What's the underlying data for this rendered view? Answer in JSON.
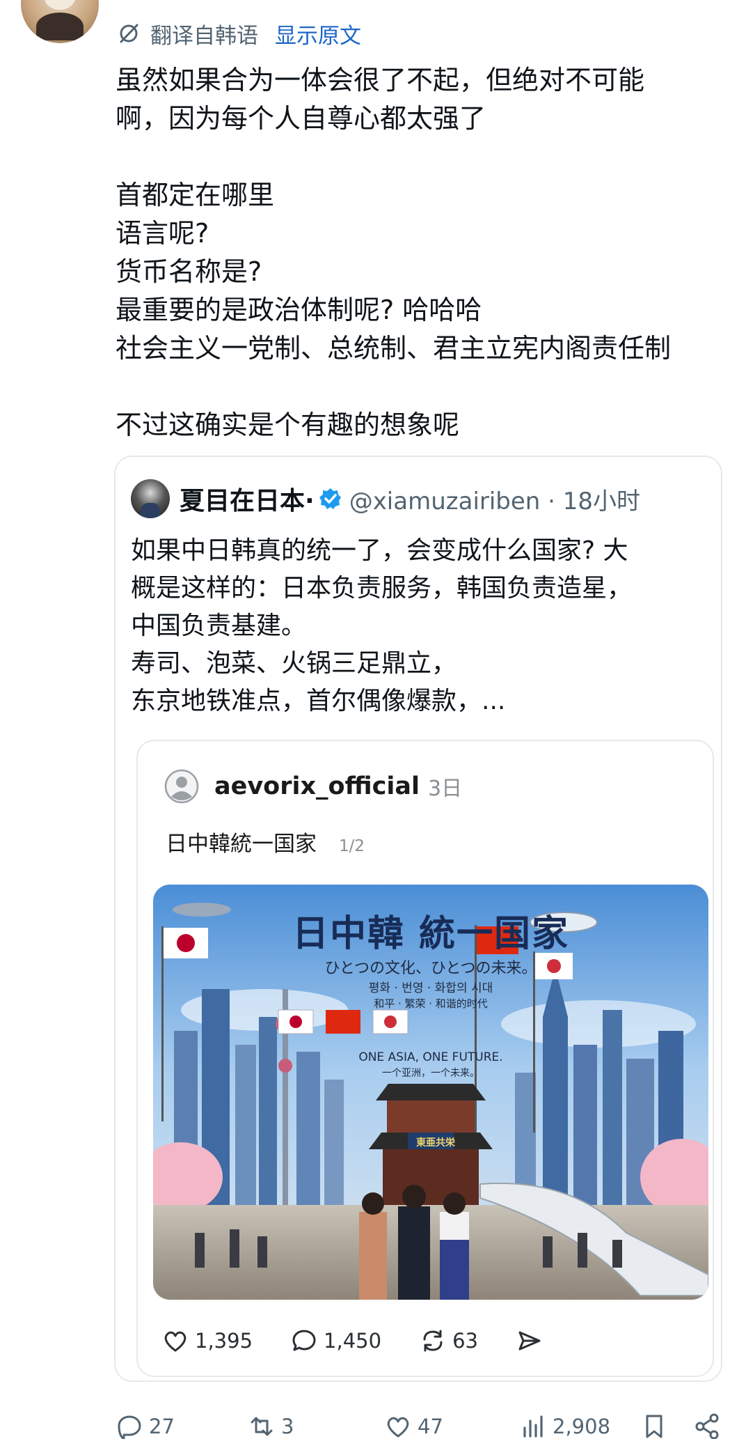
{
  "translation": {
    "label": "翻译自韩语",
    "show_original": "显示原文"
  },
  "post": {
    "lines": [
      "虽然如果合为一体会很了不起，但绝对不可能",
      "啊，因为每个人自尊心都太强了",
      "",
      "首都定在哪里",
      "语言呢?",
      "货币名称是?",
      "最重要的是政治体制呢? 哈哈哈",
      "社会主义一党制、总统制、君主立宪内阁责任制",
      "",
      "不过这确实是个有趣的想象呢"
    ]
  },
  "quote": {
    "name": "夏目在日本·",
    "handle": "@xiamuzairiben · 18小时",
    "lines": [
      "如果中日韩真的统一了，会变成什么国家? 大",
      "概是这样的：日本负责服务，韩国负责造星，",
      "中国负责基建。",
      "寿司、泡菜、火锅三足鼎立，",
      "东京地铁准点，首尔偶像爆款，..."
    ],
    "inner": {
      "username": "aevorix_official",
      "time": "3日",
      "title": "日中韓統一国家",
      "page_indicator": "1/2",
      "image_text": {
        "title": "日中韓 統一国家",
        "subtitle_ja": "ひとつの文化、ひとつの未来。",
        "subtitle_ko": "평화 · 번영 · 화합의 시대",
        "subtitle_zh": "和平 · 繁荣 · 和谐的时代",
        "slogan_en": "ONE ASIA, ONE FUTURE.",
        "slogan_zh": "一个亚洲，一个未来。",
        "gate_sign": "東亜共栄"
      },
      "actions": {
        "likes": "1,395",
        "replies": "1,450",
        "reposts": "63"
      }
    }
  },
  "bottom_actions": {
    "replies": "27",
    "retweets": "3",
    "likes": "47",
    "views": "2,908"
  },
  "colors": {
    "link": "#1d66c8",
    "verified": "#1d9bf0",
    "secondary_text": "#536471",
    "border": "#e6e9ec"
  }
}
